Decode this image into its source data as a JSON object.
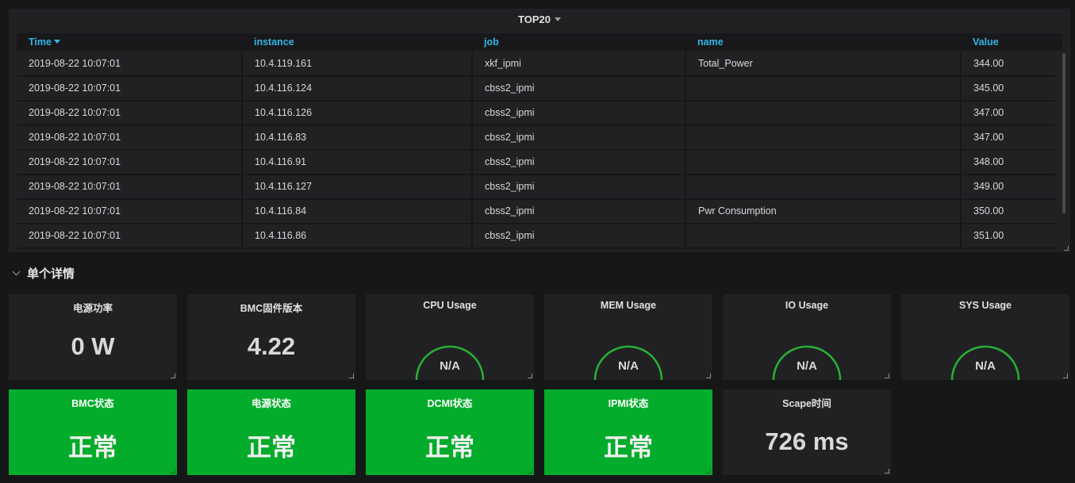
{
  "top_panel": {
    "title": "TOP20",
    "columns": [
      "Time",
      "instance",
      "job",
      "name",
      "Value"
    ],
    "rows": [
      [
        "2019-08-22 10:07:01",
        "10.4.119.161",
        "xkf_ipmi",
        "Total_Power",
        "344.00"
      ],
      [
        "2019-08-22 10:07:01",
        "10.4.116.124",
        "cbss2_ipmi",
        "",
        "345.00"
      ],
      [
        "2019-08-22 10:07:01",
        "10.4.116.126",
        "cbss2_ipmi",
        "",
        "347.00"
      ],
      [
        "2019-08-22 10:07:01",
        "10.4.116.83",
        "cbss2_ipmi",
        "",
        "347.00"
      ],
      [
        "2019-08-22 10:07:01",
        "10.4.116.91",
        "cbss2_ipmi",
        "",
        "348.00"
      ],
      [
        "2019-08-22 10:07:01",
        "10.4.116.127",
        "cbss2_ipmi",
        "",
        "349.00"
      ],
      [
        "2019-08-22 10:07:01",
        "10.4.116.84",
        "cbss2_ipmi",
        "Pwr Consumption",
        "350.00"
      ],
      [
        "2019-08-22 10:07:01",
        "10.4.116.86",
        "cbss2_ipmi",
        "",
        "351.00"
      ]
    ]
  },
  "row_section": {
    "title": "单个详情"
  },
  "stats": {
    "power": {
      "title": "电源功率",
      "value": "0 W"
    },
    "bmc_fw": {
      "title": "BMC固件版本",
      "value": "4.22"
    },
    "cpu": {
      "title": "CPU Usage",
      "value": "N/A"
    },
    "mem": {
      "title": "MEM Usage",
      "value": "N/A"
    },
    "io": {
      "title": "IO Usage",
      "value": "N/A"
    },
    "sys": {
      "title": "SYS Usage",
      "value": "N/A"
    },
    "bmc_status": {
      "title": "BMC状态",
      "value": "正常"
    },
    "power_status": {
      "title": "电源状态",
      "value": "正常"
    },
    "dcmi_status": {
      "title": "DCMI状态",
      "value": "正常"
    },
    "ipmi_status": {
      "title": "IPMI状态",
      "value": "正常"
    },
    "scrape_time": {
      "title": "Scape时间",
      "value": "726 ms"
    }
  },
  "colors": {
    "background": "#161719",
    "panel": "#212124",
    "header_link": "#33b5e5",
    "ok_green": "#03ac2a",
    "gauge_arc": "#27b235"
  }
}
